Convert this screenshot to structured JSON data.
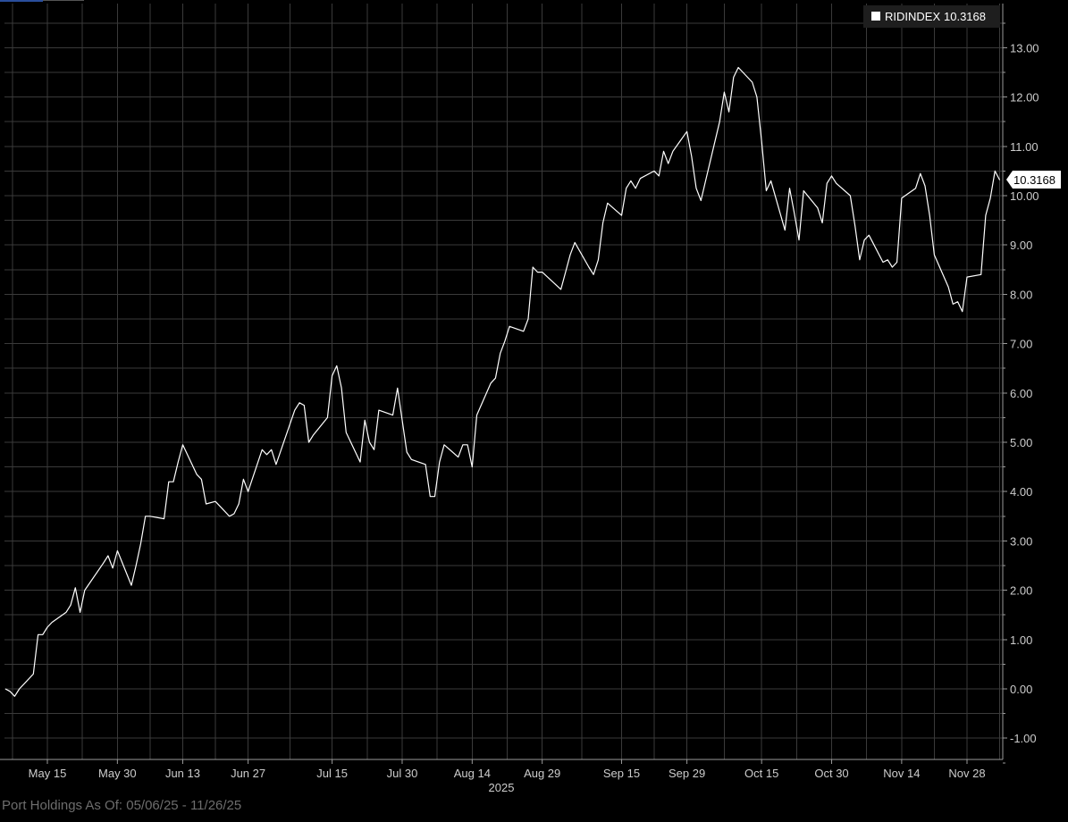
{
  "footer": {
    "label": "Port Holdings As Of:",
    "range": "05/06/25 - 11/26/25"
  },
  "legend": {
    "ticker": "RIDINDEX",
    "value": "10.3168"
  },
  "last_value_tag": "10.3168",
  "colors": {
    "background": "#000000",
    "grid": "#3a3a3a",
    "line": "#ffffff",
    "axis_text": "#cccccc",
    "footer_text": "#6d6d6d"
  },
  "chart_data": {
    "type": "line",
    "title": "",
    "xlabel": "2025",
    "ylabel": "",
    "ylim": [
      -1.5,
      13.8
    ],
    "grid": true,
    "legend_position": "top-right",
    "y_axis_side": "right",
    "y_ticks": [
      "13.00",
      "12.00",
      "11.00",
      "10.00",
      "9.00",
      "8.00",
      "7.00",
      "6.00",
      "5.00",
      "4.00",
      "3.00",
      "2.00",
      "1.00",
      "0.00",
      "-1.00"
    ],
    "x_tick_labels": [
      {
        "date": "2025-05-15",
        "label": "May 15"
      },
      {
        "date": "2025-05-30",
        "label": "May 30"
      },
      {
        "date": "2025-06-13",
        "label": "Jun 13"
      },
      {
        "date": "2025-06-27",
        "label": "Jun 27"
      },
      {
        "date": "2025-07-15",
        "label": "Jul 15"
      },
      {
        "date": "2025-07-30",
        "label": "Jul 30"
      },
      {
        "date": "2025-08-14",
        "label": "Aug 14"
      },
      {
        "date": "2025-08-29",
        "label": "Aug 29"
      },
      {
        "date": "2025-09-15",
        "label": "Sep 15"
      },
      {
        "date": "2025-09-29",
        "label": "Sep 29"
      },
      {
        "date": "2025-10-15",
        "label": "Oct 15"
      },
      {
        "date": "2025-10-30",
        "label": "Oct 30"
      },
      {
        "date": "2025-11-14",
        "label": "Nov 14"
      },
      {
        "date": "2025-11-28",
        "label": "Nov 28"
      }
    ],
    "series": [
      {
        "name": "RIDINDEX",
        "values": [
          [
            "2025-05-06",
            0.0
          ],
          [
            "2025-05-07",
            -0.05
          ],
          [
            "2025-05-08",
            -0.15
          ],
          [
            "2025-05-09",
            0.0
          ],
          [
            "2025-05-12",
            0.3
          ],
          [
            "2025-05-13",
            1.1
          ],
          [
            "2025-05-14",
            1.1
          ],
          [
            "2025-05-15",
            1.25
          ],
          [
            "2025-05-16",
            1.35
          ],
          [
            "2025-05-19",
            1.55
          ],
          [
            "2025-05-20",
            1.7
          ],
          [
            "2025-05-21",
            2.05
          ],
          [
            "2025-05-22",
            1.55
          ],
          [
            "2025-05-23",
            2.0
          ],
          [
            "2025-05-27",
            2.55
          ],
          [
            "2025-05-28",
            2.7
          ],
          [
            "2025-05-29",
            2.45
          ],
          [
            "2025-05-30",
            2.8
          ],
          [
            "2025-06-02",
            2.1
          ],
          [
            "2025-06-03",
            2.5
          ],
          [
            "2025-06-04",
            2.95
          ],
          [
            "2025-06-05",
            3.5
          ],
          [
            "2025-06-06",
            3.5
          ],
          [
            "2025-06-09",
            3.45
          ],
          [
            "2025-06-10",
            4.2
          ],
          [
            "2025-06-11",
            4.2
          ],
          [
            "2025-06-12",
            4.6
          ],
          [
            "2025-06-13",
            4.95
          ],
          [
            "2025-06-16",
            4.35
          ],
          [
            "2025-06-17",
            4.25
          ],
          [
            "2025-06-18",
            3.75
          ],
          [
            "2025-06-20",
            3.8
          ],
          [
            "2025-06-23",
            3.5
          ],
          [
            "2025-06-24",
            3.55
          ],
          [
            "2025-06-25",
            3.75
          ],
          [
            "2025-06-26",
            4.25
          ],
          [
            "2025-06-27",
            4.0
          ],
          [
            "2025-06-30",
            4.85
          ],
          [
            "2025-07-01",
            4.75
          ],
          [
            "2025-07-02",
            4.85
          ],
          [
            "2025-07-03",
            4.55
          ],
          [
            "2025-07-07",
            5.65
          ],
          [
            "2025-07-08",
            5.8
          ],
          [
            "2025-07-09",
            5.75
          ],
          [
            "2025-07-10",
            5.0
          ],
          [
            "2025-07-11",
            5.15
          ],
          [
            "2025-07-14",
            5.5
          ],
          [
            "2025-07-15",
            6.35
          ],
          [
            "2025-07-16",
            6.55
          ],
          [
            "2025-07-17",
            6.1
          ],
          [
            "2025-07-18",
            5.2
          ],
          [
            "2025-07-21",
            4.6
          ],
          [
            "2025-07-22",
            5.45
          ],
          [
            "2025-07-23",
            5.0
          ],
          [
            "2025-07-24",
            4.85
          ],
          [
            "2025-07-25",
            5.65
          ],
          [
            "2025-07-28",
            5.55
          ],
          [
            "2025-07-29",
            6.1
          ],
          [
            "2025-07-30",
            5.45
          ],
          [
            "2025-07-31",
            4.8
          ],
          [
            "2025-08-01",
            4.65
          ],
          [
            "2025-08-04",
            4.55
          ],
          [
            "2025-08-05",
            3.9
          ],
          [
            "2025-08-06",
            3.9
          ],
          [
            "2025-08-07",
            4.6
          ],
          [
            "2025-08-08",
            4.95
          ],
          [
            "2025-08-11",
            4.7
          ],
          [
            "2025-08-12",
            4.95
          ],
          [
            "2025-08-13",
            4.95
          ],
          [
            "2025-08-14",
            4.5
          ],
          [
            "2025-08-15",
            5.55
          ],
          [
            "2025-08-18",
            6.2
          ],
          [
            "2025-08-19",
            6.3
          ],
          [
            "2025-08-20",
            6.8
          ],
          [
            "2025-08-21",
            7.05
          ],
          [
            "2025-08-22",
            7.35
          ],
          [
            "2025-08-25",
            7.25
          ],
          [
            "2025-08-26",
            7.5
          ],
          [
            "2025-08-27",
            8.55
          ],
          [
            "2025-08-28",
            8.45
          ],
          [
            "2025-08-29",
            8.45
          ],
          [
            "2025-09-02",
            8.1
          ],
          [
            "2025-09-03",
            8.45
          ],
          [
            "2025-09-04",
            8.8
          ],
          [
            "2025-09-05",
            9.05
          ],
          [
            "2025-09-08",
            8.55
          ],
          [
            "2025-09-09",
            8.4
          ],
          [
            "2025-09-10",
            8.7
          ],
          [
            "2025-09-11",
            9.45
          ],
          [
            "2025-09-12",
            9.85
          ],
          [
            "2025-09-15",
            9.6
          ],
          [
            "2025-09-16",
            10.15
          ],
          [
            "2025-09-17",
            10.3
          ],
          [
            "2025-09-18",
            10.15
          ],
          [
            "2025-09-19",
            10.35
          ],
          [
            "2025-09-22",
            10.5
          ],
          [
            "2025-09-23",
            10.4
          ],
          [
            "2025-09-24",
            10.9
          ],
          [
            "2025-09-25",
            10.65
          ],
          [
            "2025-09-26",
            10.9
          ],
          [
            "2025-09-29",
            11.3
          ],
          [
            "2025-09-30",
            10.8
          ],
          [
            "2025-10-01",
            10.15
          ],
          [
            "2025-10-02",
            9.9
          ],
          [
            "2025-10-03",
            10.3
          ],
          [
            "2025-10-06",
            11.5
          ],
          [
            "2025-10-07",
            12.1
          ],
          [
            "2025-10-08",
            11.7
          ],
          [
            "2025-10-09",
            12.4
          ],
          [
            "2025-10-10",
            12.6
          ],
          [
            "2025-10-13",
            12.3
          ],
          [
            "2025-10-14",
            12.0
          ],
          [
            "2025-10-15",
            11.1
          ],
          [
            "2025-10-16",
            10.1
          ],
          [
            "2025-10-17",
            10.3
          ],
          [
            "2025-10-20",
            9.3
          ],
          [
            "2025-10-21",
            10.15
          ],
          [
            "2025-10-22",
            9.65
          ],
          [
            "2025-10-23",
            9.1
          ],
          [
            "2025-10-24",
            10.1
          ],
          [
            "2025-10-27",
            9.75
          ],
          [
            "2025-10-28",
            9.45
          ],
          [
            "2025-10-29",
            10.25
          ],
          [
            "2025-10-30",
            10.4
          ],
          [
            "2025-10-31",
            10.25
          ],
          [
            "2025-11-03",
            10.0
          ],
          [
            "2025-11-04",
            9.4
          ],
          [
            "2025-11-05",
            8.7
          ],
          [
            "2025-11-06",
            9.1
          ],
          [
            "2025-11-07",
            9.2
          ],
          [
            "2025-11-10",
            8.65
          ],
          [
            "2025-11-11",
            8.7
          ],
          [
            "2025-11-12",
            8.55
          ],
          [
            "2025-11-13",
            8.65
          ],
          [
            "2025-11-14",
            9.95
          ],
          [
            "2025-11-17",
            10.15
          ],
          [
            "2025-11-18",
            10.45
          ],
          [
            "2025-11-19",
            10.2
          ],
          [
            "2025-11-20",
            9.6
          ],
          [
            "2025-11-21",
            8.8
          ],
          [
            "2025-11-24",
            8.15
          ],
          [
            "2025-11-25",
            7.8
          ],
          [
            "2025-11-26",
            7.85
          ],
          [
            "2025-11-27",
            7.65
          ],
          [
            "2025-11-28",
            8.35
          ],
          [
            "2025-12-01",
            8.4
          ],
          [
            "2025-12-02",
            9.6
          ],
          [
            "2025-12-03",
            9.95
          ],
          [
            "2025-12-04",
            10.5
          ],
          [
            "2025-12-05",
            10.3168
          ]
        ]
      }
    ]
  }
}
